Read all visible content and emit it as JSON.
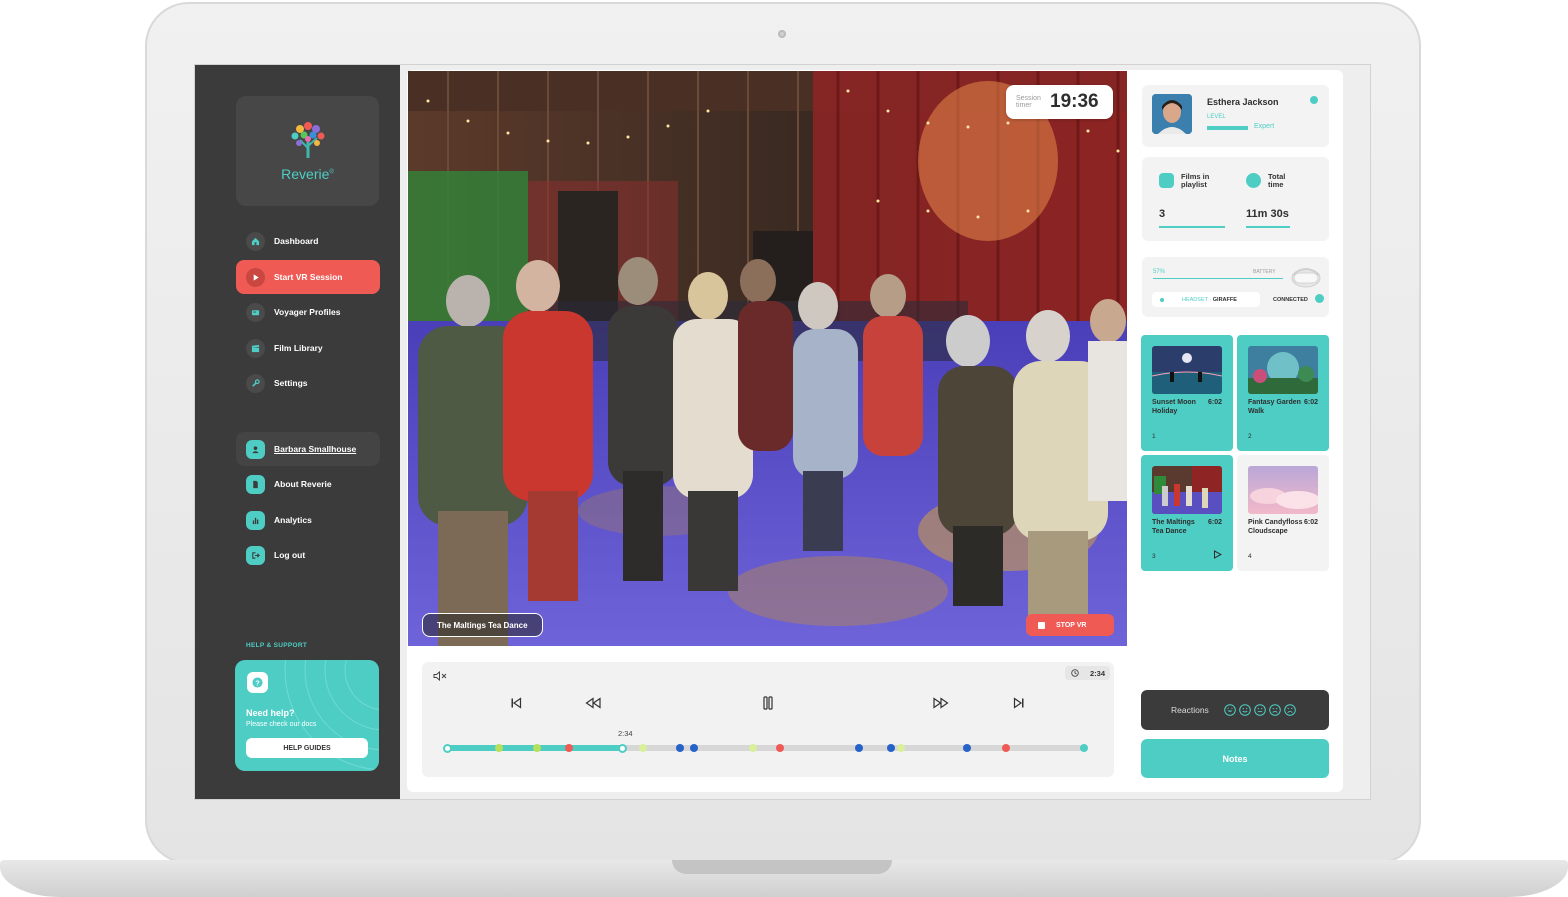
{
  "brand": {
    "name": "Reverie",
    "trademark": "®",
    "accent": "#4ecdc4",
    "danger": "#ef5a55"
  },
  "sidebar": {
    "nav": [
      {
        "label": "Dashboard",
        "icon": "home-icon",
        "active": false
      },
      {
        "label": "Start VR Session",
        "icon": "play-icon",
        "active": true
      },
      {
        "label": "Voyager Profiles",
        "icon": "id-card-icon",
        "active": false
      },
      {
        "label": "Film Library",
        "icon": "clapperboard-icon",
        "active": false
      },
      {
        "label": "Settings",
        "icon": "wrench-icon",
        "active": false
      }
    ],
    "account": [
      {
        "label": "Barbara Smallhouse",
        "icon": "user-icon"
      },
      {
        "label": "About Reverie",
        "icon": "document-icon"
      },
      {
        "label": "Analytics",
        "icon": "bar-chart-icon"
      },
      {
        "label": "Log out",
        "icon": "logout-icon"
      }
    ],
    "help": {
      "section_label": "HELP & SUPPORT",
      "title": "Need help?",
      "subtitle": "Please check our docs",
      "button": "HELP GUIDES"
    }
  },
  "video": {
    "timer_label": "Session timer",
    "timer_value": "19:36",
    "film_label": "The Maltings Tea Dance",
    "stop_label": "STOP VR"
  },
  "player": {
    "time_display": "2:34",
    "progress_time": "2:34",
    "progress_fraction": 0.275,
    "markers": [
      {
        "pos": 0.0,
        "color": "#ffffff"
      },
      {
        "pos": 0.082,
        "color": "#b6e05a"
      },
      {
        "pos": 0.141,
        "color": "#b6e05a"
      },
      {
        "pos": 0.191,
        "color": "#ef5a55"
      },
      {
        "pos": 0.275,
        "color": "#ffffff"
      },
      {
        "pos": 0.308,
        "color": "#d9ef9a"
      },
      {
        "pos": 0.366,
        "color": "#2563c9"
      },
      {
        "pos": 0.388,
        "color": "#2563c9"
      },
      {
        "pos": 0.48,
        "color": "#d9ef9a"
      },
      {
        "pos": 0.522,
        "color": "#ef5a55"
      },
      {
        "pos": 0.646,
        "color": "#2563c9"
      },
      {
        "pos": 0.697,
        "color": "#2563c9"
      },
      {
        "pos": 0.713,
        "color": "#d9ef9a"
      },
      {
        "pos": 0.817,
        "color": "#2563c9"
      },
      {
        "pos": 0.878,
        "color": "#ef5a55"
      },
      {
        "pos": 1.0,
        "color": "#4ecdc4"
      }
    ]
  },
  "profile": {
    "name": "Esthera Jackson",
    "level_label": "LEVEL",
    "level_value": "Expert"
  },
  "stats": {
    "films_label": "Films in playlist",
    "films_value": "3",
    "time_label": "Total time",
    "time_value": "11m 30s"
  },
  "device": {
    "battery_pct": "57%",
    "battery_label": "BATTERY",
    "headset_prefix": "HEADSET ·",
    "headset_name": "GIRAFFE",
    "status": "CONNECTED"
  },
  "playlist": [
    {
      "title": "Sunset Moon Holiday",
      "duration": "6:02",
      "index": "1",
      "selected": true
    },
    {
      "title": "Fantasy Garden Walk",
      "duration": "6:02",
      "index": "2",
      "selected": true
    },
    {
      "title": "The Maltings Tea Dance",
      "duration": "6:02",
      "index": "3",
      "selected": true,
      "playing": true
    },
    {
      "title": "Pink Candyfloss Cloudscape",
      "duration": "6:02",
      "index": "4",
      "selected": false
    }
  ],
  "reactions_label": "Reactions",
  "notes_label": "Notes"
}
